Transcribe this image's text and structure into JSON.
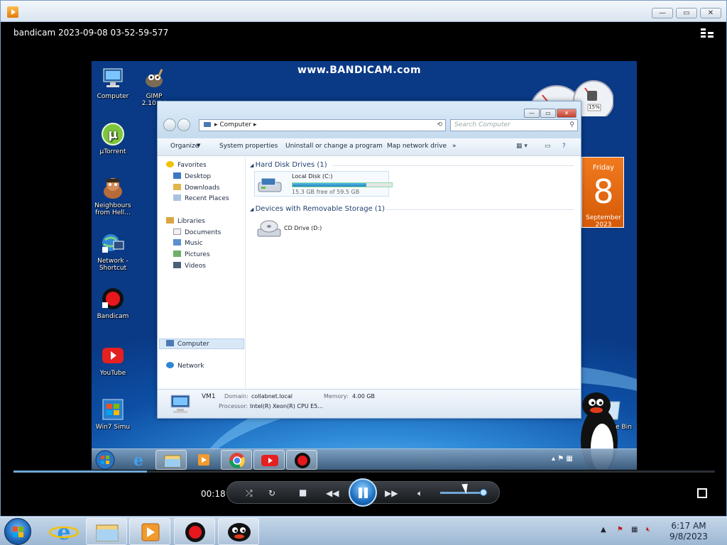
{
  "player": {
    "title": "bandicam 2023-09-08 03-52-59-577",
    "caption_buttons": [
      "minimize",
      "restore",
      "close"
    ],
    "elapsed": "00:18",
    "progress_fraction": 0.19,
    "volume_fraction": 0.9,
    "controls": [
      "shuffle-icon",
      "repeat-icon",
      "stop-icon",
      "previous-icon",
      "pause-icon",
      "next-icon",
      "volume-icon"
    ]
  },
  "video": {
    "watermark": "www.BANDICAM.com",
    "desktop_icons": [
      {
        "label": "Computer",
        "icon": "computer-icon"
      },
      {
        "label": "GIMP 2.10.24",
        "icon": "gimp-icon"
      },
      {
        "label": "µTorrent",
        "icon": "utorrent-icon"
      },
      {
        "label": "Neighbours from Hell...",
        "icon": "game-icon"
      },
      {
        "label": "Network - Shortcut",
        "icon": "network-icon"
      },
      {
        "label": "Bandicam",
        "icon": "bandicam-icon"
      },
      {
        "label": "YouTube",
        "icon": "youtube-icon"
      },
      {
        "label": "Win7 Simu",
        "icon": "win7-icon"
      },
      {
        "label": "Recycle Bin",
        "icon": "recycle-bin-icon"
      }
    ],
    "cpu_gadget": {
      "percent": "15%"
    },
    "calendar": {
      "day": "Friday",
      "date": "8",
      "month": "September 2023"
    },
    "explorer": {
      "breadcrumb": "Computer",
      "search_placeholder": "Search Computer",
      "toolbar": [
        "Organize",
        "System properties",
        "Uninstall or change a program",
        "Map network drive",
        "»"
      ],
      "nav": {
        "favorites": "Favorites",
        "fav_items": [
          "Desktop",
          "Downloads",
          "Recent Places"
        ],
        "libraries": "Libraries",
        "lib_items": [
          "Documents",
          "Music",
          "Pictures",
          "Videos"
        ],
        "computer": "Computer",
        "network": "Network"
      },
      "groups": [
        {
          "title": "Hard Disk Drives (1)"
        },
        {
          "title": "Devices with Removable Storage (1)"
        }
      ],
      "drives": [
        {
          "name": "Local Disk (C:)",
          "free": "15.3 GB free of 59.5 GB",
          "used_fraction": 0.74
        },
        {
          "name": "CD Drive (D:)"
        }
      ],
      "details": {
        "name": "VM1",
        "domain_label": "Domain:",
        "domain": "collabnet.local",
        "memory_label": "Memory:",
        "memory": "4.00 GB",
        "processor_label": "Processor:",
        "processor": "Intel(R) Xeon(R) CPU E5..."
      }
    },
    "taskbar_icons": [
      "start-orb-icon",
      "internet-explorer-icon",
      "explorer-icon",
      "media-player-icon",
      "chrome-icon",
      "youtube-icon",
      "bandicam-icon"
    ]
  },
  "taskbar": {
    "pinned": [
      "internet-explorer-icon",
      "explorer-icon",
      "media-player-icon",
      "bandicam-icon",
      "pingu-icon"
    ],
    "time": "6:17 AM",
    "date": "9/8/2023"
  },
  "colors": {
    "accent": "#1d6fc0",
    "calendar": "#e8661a",
    "player_bg": "#000000"
  }
}
